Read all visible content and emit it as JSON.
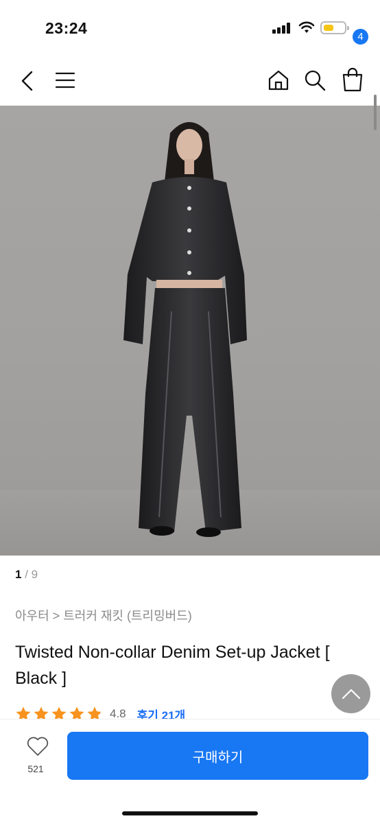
{
  "status": {
    "time": "23:24"
  },
  "cart": {
    "count": "4"
  },
  "gallery": {
    "current": "1",
    "total": "9",
    "separator": "/"
  },
  "product": {
    "breadcrumb": "아우터 > 트러커 재킷 (트리밍버드)",
    "title": "Twisted Non-collar Denim Set-up Jacket [ Black ]",
    "rating": "4.8",
    "stars_filled": 4.8,
    "review_link": "후기 21개"
  },
  "actions": {
    "like_count": "521",
    "buy_label": "구매하기"
  },
  "colors": {
    "accent": "#1877f2",
    "star": "#f7931e",
    "badge": "#1877f2"
  },
  "icons": [
    "back-icon",
    "menu-icon",
    "home-icon",
    "search-icon",
    "shopping-bag-icon",
    "star-icon",
    "chevron-up-icon",
    "heart-icon"
  ]
}
